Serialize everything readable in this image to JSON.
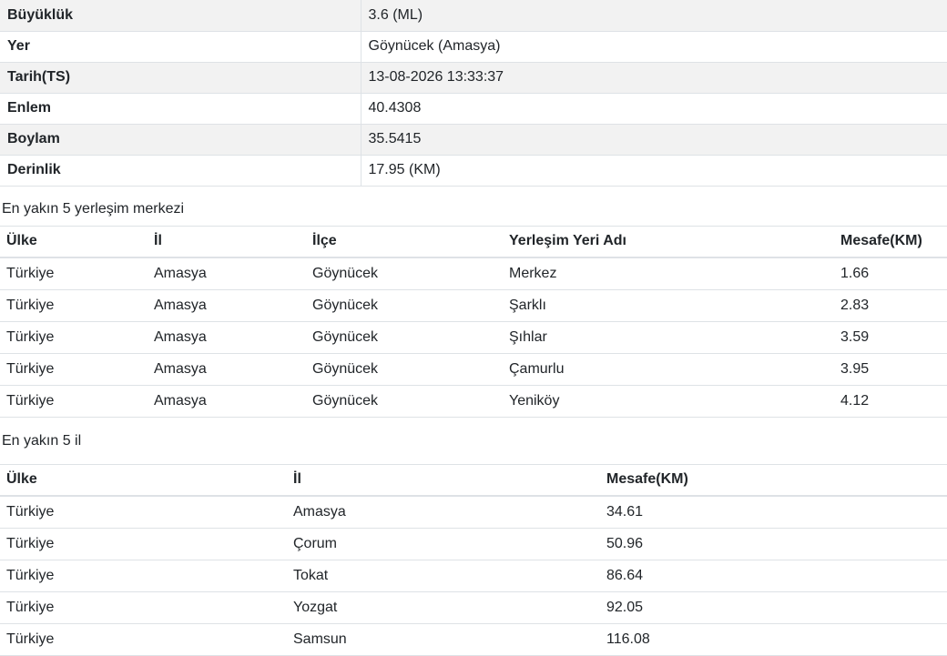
{
  "details": [
    {
      "label": "Büyüklük",
      "value": "3.6 (ML)"
    },
    {
      "label": "Yer",
      "value": "Göynücek (Amasya)"
    },
    {
      "label": "Tarih(TS)",
      "value": "13-08-2026 13:33:37"
    },
    {
      "label": "Enlem",
      "value": "40.4308"
    },
    {
      "label": "Boylam",
      "value": "35.5415"
    },
    {
      "label": "Derinlik",
      "value": "17.95 (KM)"
    }
  ],
  "settlements": {
    "caption": "En yakın 5 yerleşim merkezi",
    "headers": [
      "Ülke",
      "İl",
      "İlçe",
      "Yerleşim Yeri Adı",
      "Mesafe(KM)"
    ],
    "rows": [
      [
        "Türkiye",
        "Amasya",
        "Göynücek",
        "Merkez",
        "1.66"
      ],
      [
        "Türkiye",
        "Amasya",
        "Göynücek",
        "Şarklı",
        "2.83"
      ],
      [
        "Türkiye",
        "Amasya",
        "Göynücek",
        "Şıhlar",
        "3.59"
      ],
      [
        "Türkiye",
        "Amasya",
        "Göynücek",
        "Çamurlu",
        "3.95"
      ],
      [
        "Türkiye",
        "Amasya",
        "Göynücek",
        "Yeniköy",
        "4.12"
      ]
    ]
  },
  "provinces": {
    "caption": "En yakın 5 il",
    "headers": [
      "Ülke",
      "İl",
      "Mesafe(KM)"
    ],
    "rows": [
      [
        "Türkiye",
        "Amasya",
        "34.61"
      ],
      [
        "Türkiye",
        "Çorum",
        "50.96"
      ],
      [
        "Türkiye",
        "Tokat",
        "86.64"
      ],
      [
        "Türkiye",
        "Yozgat",
        "92.05"
      ],
      [
        "Türkiye",
        "Samsun",
        "116.08"
      ]
    ]
  }
}
